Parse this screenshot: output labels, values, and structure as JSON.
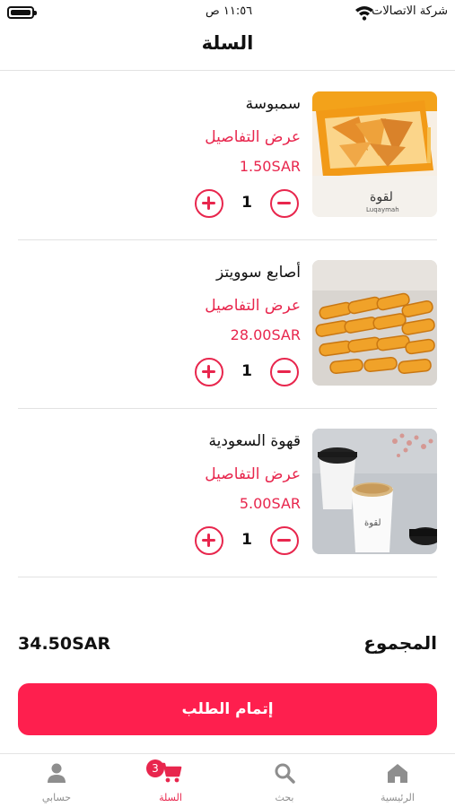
{
  "status_bar": {
    "carrier": "شركة الاتصالات",
    "time": "١١:٥٦ ص"
  },
  "header": {
    "title": "السلة"
  },
  "cart": {
    "items": [
      {
        "name": "سمبوسة",
        "details_link": "عرض التفاصيل",
        "price": "1.50SAR",
        "quantity": "1",
        "image": "samosa-box-photo"
      },
      {
        "name": "أصابع سوويتز",
        "details_link": "عرض التفاصيل",
        "price": "28.00SAR",
        "quantity": "1",
        "image": "sweet-rolls-photo"
      },
      {
        "name": "قهوة السعودية",
        "details_link": "عرض التفاصيل",
        "price": "5.00SAR",
        "quantity": "1",
        "image": "coffee-cups-photo"
      }
    ]
  },
  "total": {
    "label": "المجموع",
    "value": "34.50SAR"
  },
  "checkout": {
    "label": "إتمام الطلب"
  },
  "tab_bar": {
    "tabs": [
      {
        "label": "الرئيسية",
        "icon": "home-icon"
      },
      {
        "label": "بحث",
        "icon": "search-icon"
      },
      {
        "label": "السلة",
        "icon": "cart-icon",
        "badge": "3",
        "active": true
      },
      {
        "label": "حسابي",
        "icon": "person-icon"
      }
    ]
  },
  "colors": {
    "accent": "#e8264d",
    "checkout_button": "#fe1f4e",
    "inactive_tab": "#8e8e8e"
  }
}
